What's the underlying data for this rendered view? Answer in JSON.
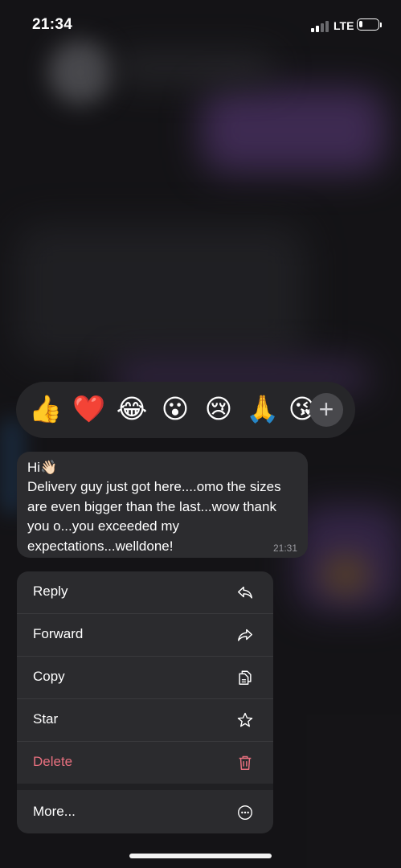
{
  "status_bar": {
    "time": "21:34",
    "network": "LTE",
    "battery_level": 0.2
  },
  "reactions": {
    "emojis": [
      "👍",
      "❤️",
      "😂",
      "😮",
      "😢",
      "🙏",
      "😘"
    ],
    "add_label": "+"
  },
  "message": {
    "greeting": "Hi👋🏻",
    "body": "Delivery guy just got here....omo the sizes are even bigger than the last...wow thank you o...you exceeded my expectations...welldone!",
    "time": "21:31"
  },
  "menu": {
    "reply": "Reply",
    "forward": "Forward",
    "copy": "Copy",
    "star": "Star",
    "delete": "Delete",
    "more": "More..."
  },
  "colors": {
    "delete": "#e8707f",
    "menu_bg": "#2b2b2e",
    "bubble_bg": "#2c2c2f"
  },
  "icons": {
    "reply": "reply-arrow-icon",
    "forward": "forward-arrow-icon",
    "copy": "copy-icon",
    "star": "star-icon",
    "delete": "trash-icon",
    "more": "more-ellipsis-icon"
  }
}
